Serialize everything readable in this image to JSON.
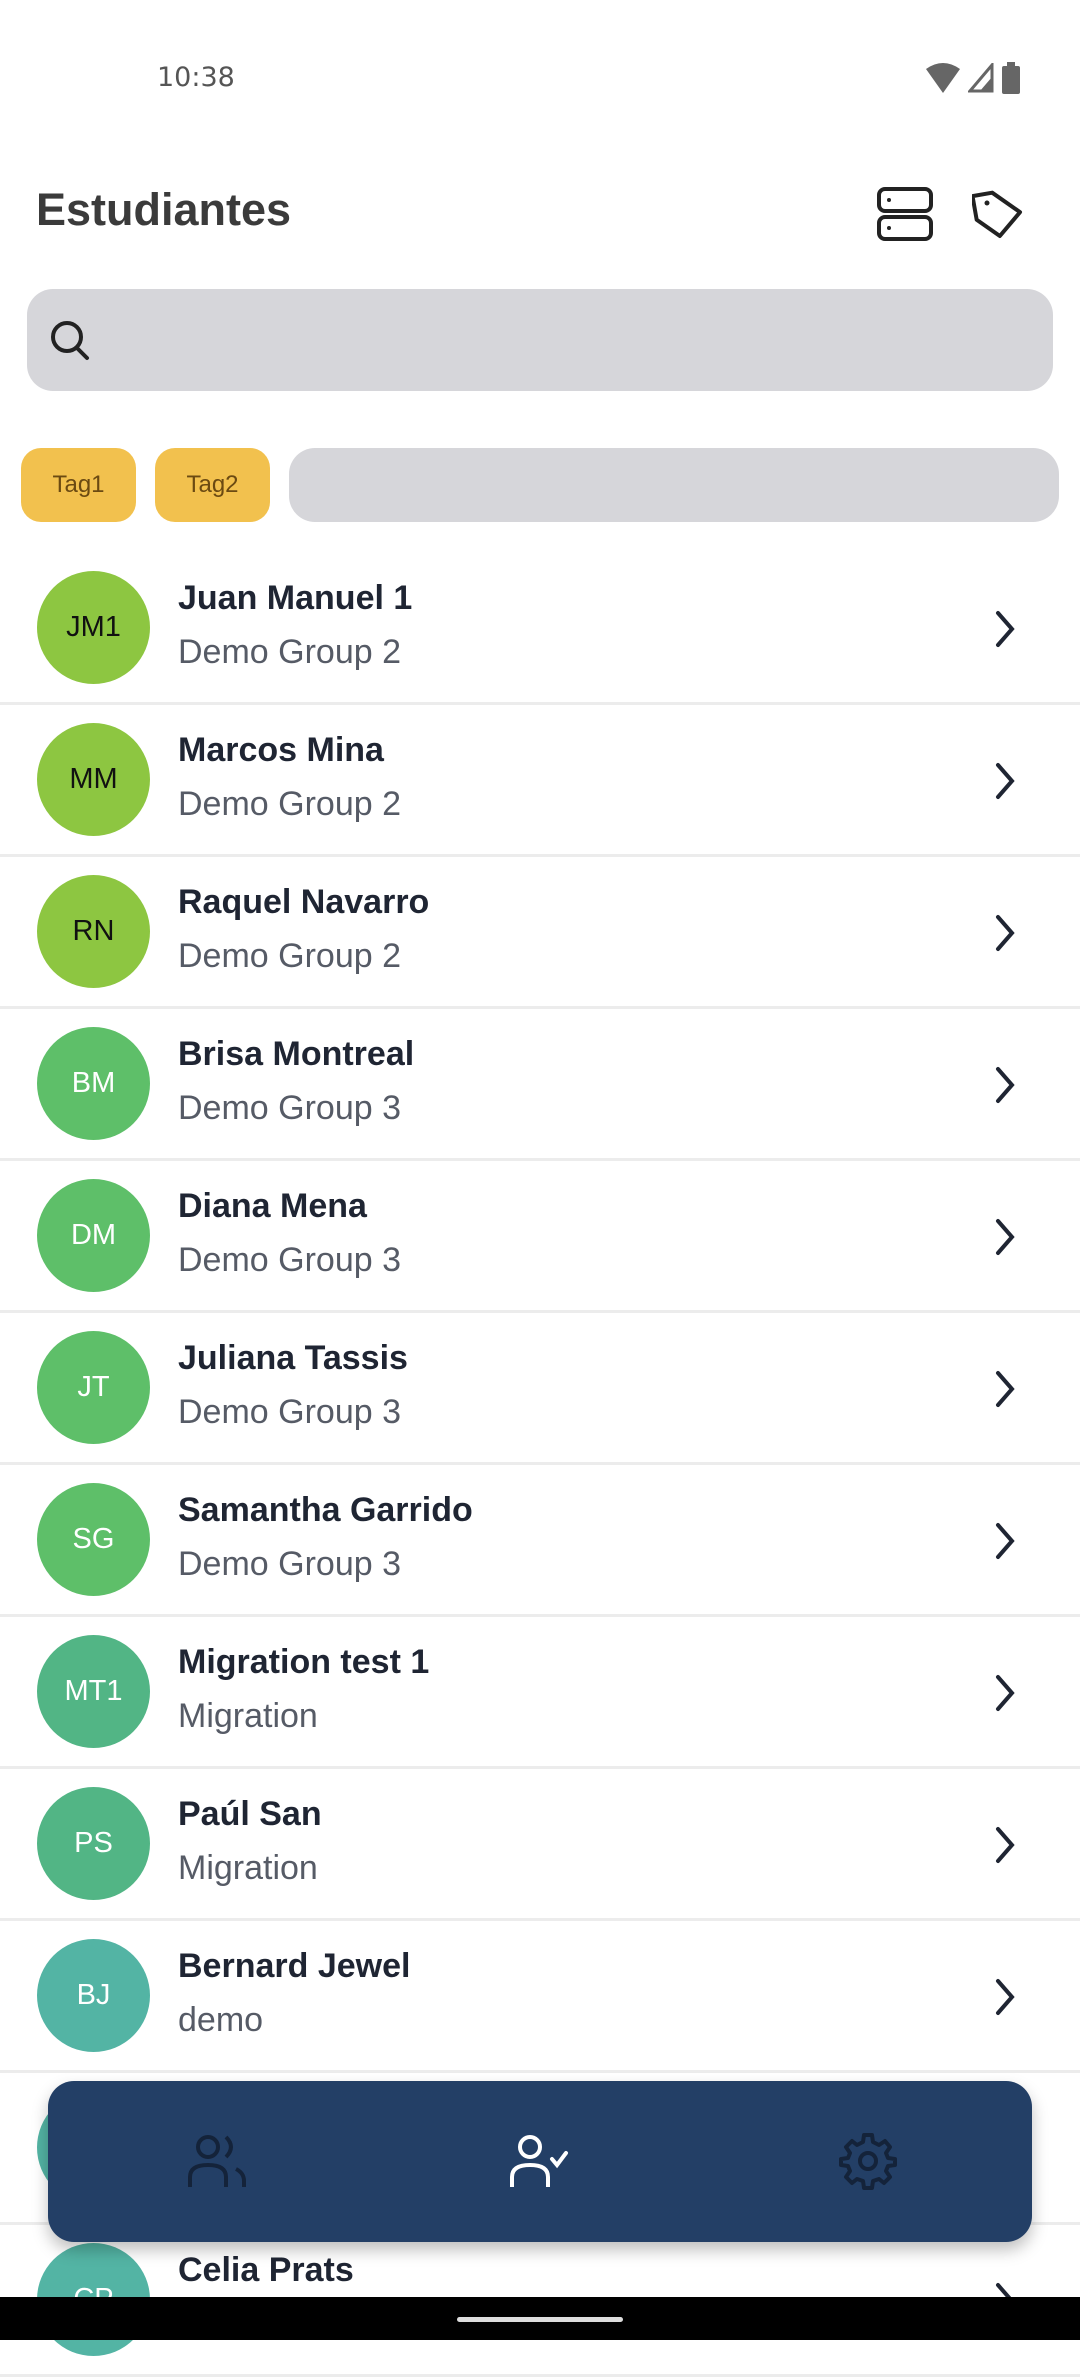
{
  "status_bar": {
    "time": "10:38",
    "icons": [
      "wifi-icon",
      "signal-icon",
      "battery-icon"
    ]
  },
  "header": {
    "title": "Estudiantes",
    "actions": [
      {
        "icon": "list-view-icon"
      },
      {
        "icon": "tag-icon"
      }
    ]
  },
  "search": {
    "value": "",
    "placeholder": "",
    "icon": "search-icon"
  },
  "tags": [
    {
      "label": "Tag1"
    },
    {
      "label": "Tag2"
    }
  ],
  "colors": {
    "tag": "#f2c14e",
    "nav": "#233f66",
    "field": "#d6d6da"
  },
  "students": [
    {
      "initials": "JM1",
      "name": "Juan Manuel 1",
      "group": "Demo Group 2",
      "color": "#8dc641",
      "text_color": "#111111"
    },
    {
      "initials": "MM",
      "name": "Marcos Mina",
      "group": "Demo Group 2",
      "color": "#8dc641",
      "text_color": "#111111"
    },
    {
      "initials": "RN",
      "name": "Raquel Navarro",
      "group": "Demo Group 2",
      "color": "#8dc641",
      "text_color": "#111111"
    },
    {
      "initials": "BM",
      "name": "Brisa Montreal",
      "group": "Demo Group 3",
      "color": "#5ebf69",
      "text_color": "#ffffff"
    },
    {
      "initials": "DM",
      "name": "Diana Mena",
      "group": "Demo Group 3",
      "color": "#5ebf69",
      "text_color": "#ffffff"
    },
    {
      "initials": "JT",
      "name": "Juliana Tassis",
      "group": "Demo Group 3",
      "color": "#5ebf69",
      "text_color": "#ffffff"
    },
    {
      "initials": "SG",
      "name": "Samantha Garrido",
      "group": "Demo Group 3",
      "color": "#5ebf69",
      "text_color": "#ffffff"
    },
    {
      "initials": "MT1",
      "name": "Migration test 1",
      "group": "Migration",
      "color": "#52b585",
      "text_color": "#ffffff"
    },
    {
      "initials": "PS",
      "name": "Paúl San",
      "group": "Migration",
      "color": "#52b585",
      "text_color": "#ffffff"
    },
    {
      "initials": "BJ",
      "name": "Bernard Jewel",
      "group": "demo",
      "color": "#53b4a4",
      "text_color": "#ffffff"
    },
    {
      "initials": "",
      "name": "",
      "group": "",
      "color": "#53b4a4",
      "text_color": "#ffffff"
    },
    {
      "initials": "CP",
      "name": "Celia Prats",
      "group": "",
      "color": "#53b4a4",
      "text_color": "#ffffff"
    }
  ],
  "bottom_nav": {
    "items": [
      {
        "icon": "users-icon",
        "active": false
      },
      {
        "icon": "user-check-icon",
        "active": true
      },
      {
        "icon": "gear-icon",
        "active": false
      }
    ]
  }
}
